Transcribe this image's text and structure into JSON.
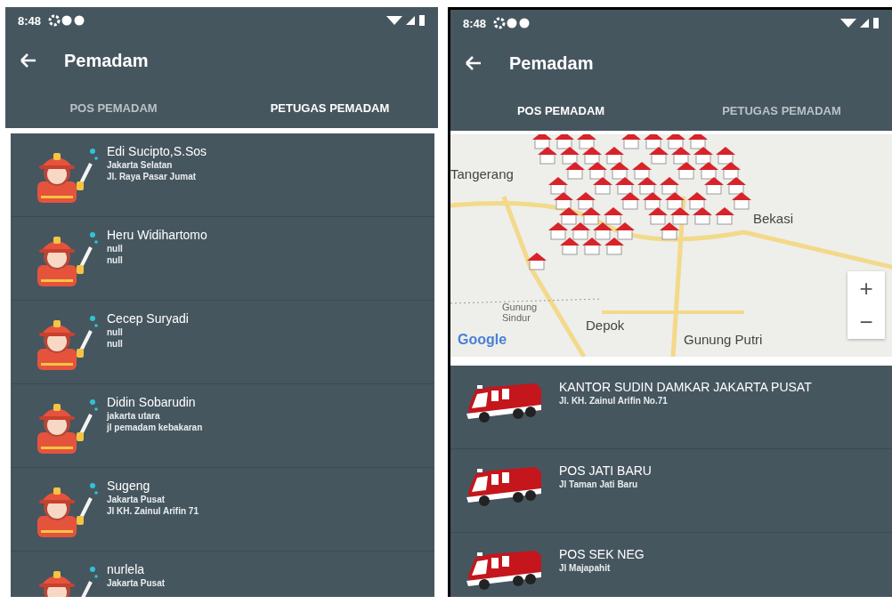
{
  "screens": [
    {
      "status_bar": {
        "time": "8:48"
      },
      "toolbar": {
        "title": "Pemadam"
      },
      "tabs": [
        {
          "label": "POS PEMADAM",
          "selected": false
        },
        {
          "label": "PETUGAS PEMADAM",
          "selected": true
        }
      ],
      "content": {
        "kind": "staff",
        "items": [
          {
            "name": "Edi Sucipto,S.Sos",
            "lines": [
              "Jakarta Selatan",
              "Jl. Raya Pasar Jumat"
            ]
          },
          {
            "name": "Heru Widihartomo",
            "lines": [
              "null",
              "null"
            ]
          },
          {
            "name": "Cecep Suryadi",
            "lines": [
              "null",
              "null"
            ]
          },
          {
            "name": "Didin Sobarudin",
            "lines": [
              "jakarta utara",
              "jl pemadam kebakaran"
            ]
          },
          {
            "name": "Sugeng",
            "lines": [
              "Jakarta Pusat",
              "Jl KH. Zainul Arifin 71"
            ]
          },
          {
            "name": "nurlela",
            "lines": [
              "Jakarta Pusat"
            ]
          }
        ]
      }
    },
    {
      "status_bar": {
        "time": "8:48"
      },
      "toolbar": {
        "title": "Pemadam"
      },
      "tabs": [
        {
          "label": "POS PEMADAM",
          "selected": true
        },
        {
          "label": "PETUGAS PEMADAM",
          "selected": false
        }
      ],
      "content": {
        "kind": "stations",
        "map": {
          "labels": [
            "Tangerang",
            "Bekasi",
            "Gunung Sindur",
            "Depok",
            "Gunung Putri"
          ],
          "attribution": "Google",
          "zoom_in": "+",
          "zoom_out": "−"
        },
        "items": [
          {
            "name": "KANTOR SUDIN DAMKAR JAKARTA PUSAT",
            "lines": [
              "Jl. KH. Zainul Arifin No.71"
            ]
          },
          {
            "name": "POS JATI BARU",
            "lines": [
              "Jl Taman Jati Baru"
            ]
          },
          {
            "name": "POS SEK NEG",
            "lines": [
              "Jl Majapahit"
            ]
          }
        ]
      }
    }
  ]
}
